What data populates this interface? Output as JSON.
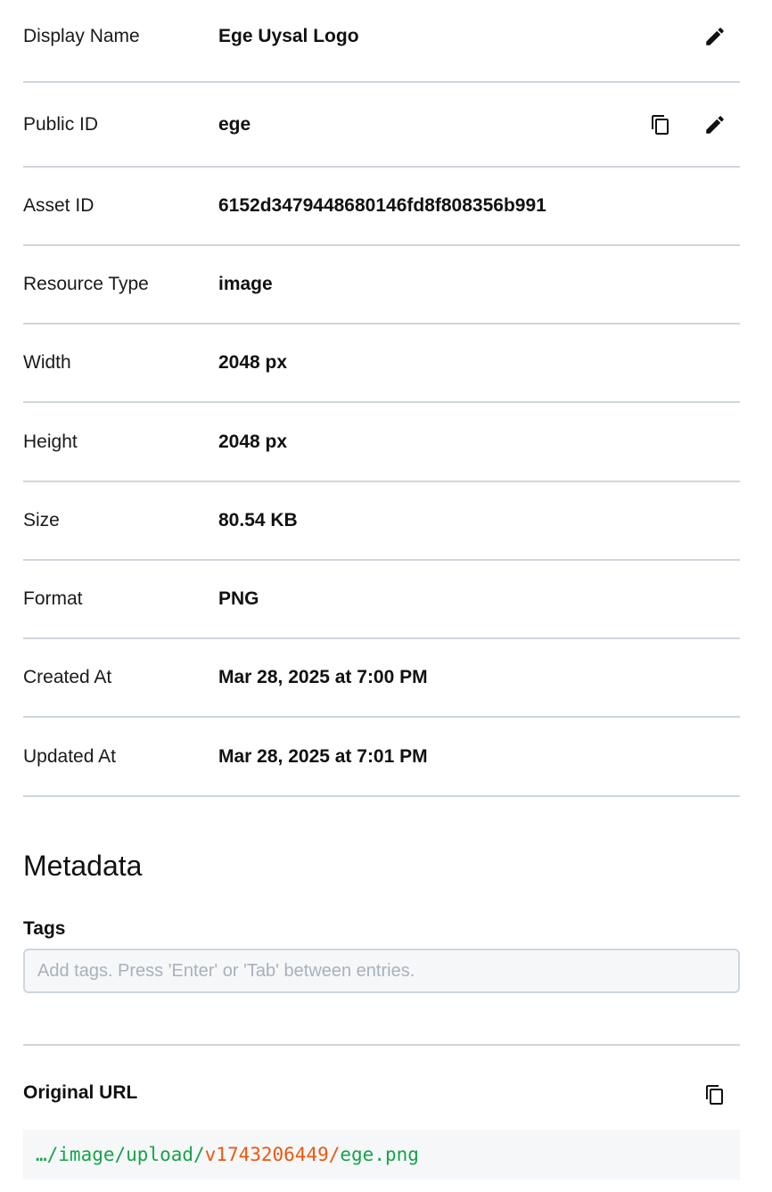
{
  "colors": {
    "divider": "#cfd6dd",
    "url_path": "#16a34a",
    "url_version": "#ea580c",
    "placeholder": "#a8b1bb"
  },
  "details": [
    {
      "key": "display-name",
      "label": "Display Name",
      "value": "Ege Uysal Logo",
      "actions": [
        "edit-icon"
      ]
    },
    {
      "key": "public-id",
      "label": "Public ID",
      "value": "ege",
      "actions": [
        "copy-icon",
        "edit-icon"
      ]
    },
    {
      "key": "asset-id",
      "label": "Asset ID",
      "value": "6152d3479448680146fd8f808356b991",
      "actions": []
    },
    {
      "key": "resource-type",
      "label": "Resource Type",
      "value": "image",
      "actions": []
    },
    {
      "key": "width",
      "label": "Width",
      "value": "2048 px",
      "actions": []
    },
    {
      "key": "height",
      "label": "Height",
      "value": "2048 px",
      "actions": []
    },
    {
      "key": "size",
      "label": "Size",
      "value": "80.54 KB",
      "actions": []
    },
    {
      "key": "format",
      "label": "Format",
      "value": "PNG",
      "actions": []
    },
    {
      "key": "created-at",
      "label": "Created At",
      "value": "Mar 28, 2025 at 7:00 PM",
      "actions": []
    },
    {
      "key": "updated-at",
      "label": "Updated At",
      "value": "Mar 28, 2025 at 7:01 PM",
      "actions": []
    }
  ],
  "metadata": {
    "title": "Metadata",
    "tags_label": "Tags",
    "tags_placeholder": "Add tags. Press 'Enter' or 'Tab' between entries.",
    "tags_value": ""
  },
  "original_url": {
    "label": "Original URL",
    "copy_icon": "copy-icon",
    "path_prefix": "…/image/upload/",
    "version": "v1743206449",
    "separator": "/",
    "filename": "ege.png"
  }
}
